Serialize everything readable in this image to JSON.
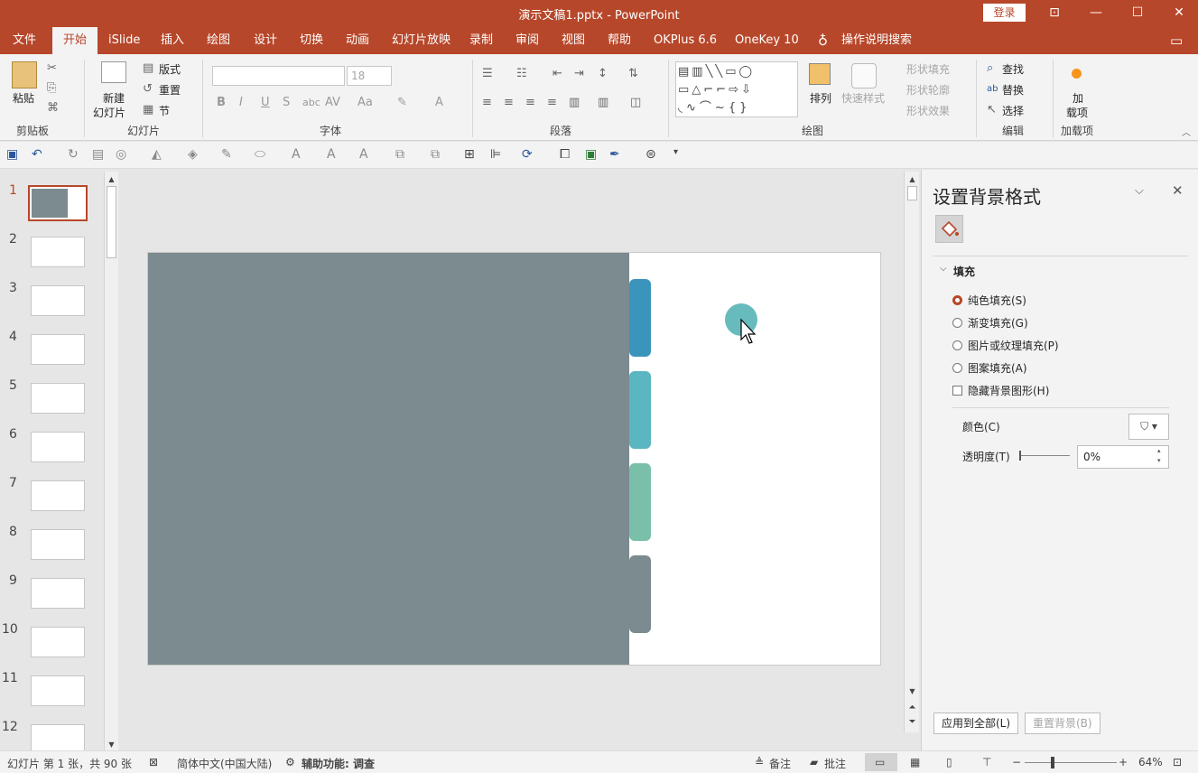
{
  "window": {
    "title": "演示文稿1.pptx  -  PowerPoint",
    "login": "登录"
  },
  "tabs": [
    {
      "label": "文件",
      "active": false
    },
    {
      "label": "开始",
      "active": true
    },
    {
      "label": "iSlide",
      "active": false
    },
    {
      "label": "插入",
      "active": false
    },
    {
      "label": "绘图",
      "active": false
    },
    {
      "label": "设计",
      "active": false
    },
    {
      "label": "切换",
      "active": false
    },
    {
      "label": "动画",
      "active": false
    },
    {
      "label": "幻灯片放映",
      "active": false
    },
    {
      "label": "录制",
      "active": false
    },
    {
      "label": "审阅",
      "active": false
    },
    {
      "label": "视图",
      "active": false
    },
    {
      "label": "帮助",
      "active": false
    },
    {
      "label": "OKPlus 6.6",
      "active": false
    },
    {
      "label": "OneKey 10",
      "active": false
    }
  ],
  "tell_me": "操作说明搜索",
  "ribbon": {
    "clipboard": {
      "group": "剪贴板",
      "paste": "粘贴"
    },
    "slides": {
      "group": "幻灯片",
      "new_slide": "新建",
      "new_slide2": "幻灯片",
      "layout": "版式",
      "reset": "重置",
      "section": "节"
    },
    "font": {
      "group": "字体",
      "size": "18"
    },
    "paragraph": {
      "group": "段落"
    },
    "drawing": {
      "group": "绘图",
      "arrange": "排列",
      "quick_styles": "快速样式",
      "shape_fill": "形状填充",
      "shape_outline": "形状轮廓",
      "shape_effects": "形状效果"
    },
    "editing": {
      "group": "编辑",
      "find": "查找",
      "replace": "替换",
      "select": "选择"
    },
    "addins": {
      "group": "加载项",
      "addin": "加",
      "addin2": "载项"
    }
  },
  "thumbnails": {
    "numbers": [
      "1",
      "2",
      "3",
      "4",
      "5",
      "6",
      "7",
      "8",
      "9",
      "10",
      "11",
      "12"
    ],
    "selected": "1"
  },
  "slide": {
    "bg_left": "#7b8b8f",
    "tabs": [
      "#3a94bc",
      "#5ab6c0",
      "#7abfa9",
      "#7b8b8f"
    ],
    "dot": "#5fb7b9"
  },
  "pane": {
    "title": "设置背景格式",
    "section": "填充",
    "options": [
      {
        "label": "纯色填充(S)",
        "checked": true
      },
      {
        "label": "渐变填充(G)",
        "checked": false
      },
      {
        "label": "图片或纹理填充(P)",
        "checked": false
      },
      {
        "label": "图案填充(A)",
        "checked": false
      }
    ],
    "hide_bg": "隐藏背景图形(H)",
    "color_label": "颜色(C)",
    "transparency_label": "透明度(T)",
    "transparency_value": "0%",
    "apply_all": "应用到全部(L)",
    "reset_bg": "重置背景(B)"
  },
  "status": {
    "slide_info": "幻灯片 第 1 张，共 90 张",
    "language": "简体中文(中国大陆)",
    "accessibility": "辅助功能: 调查",
    "notes": "备注",
    "comments": "批注",
    "zoom": "64%"
  }
}
